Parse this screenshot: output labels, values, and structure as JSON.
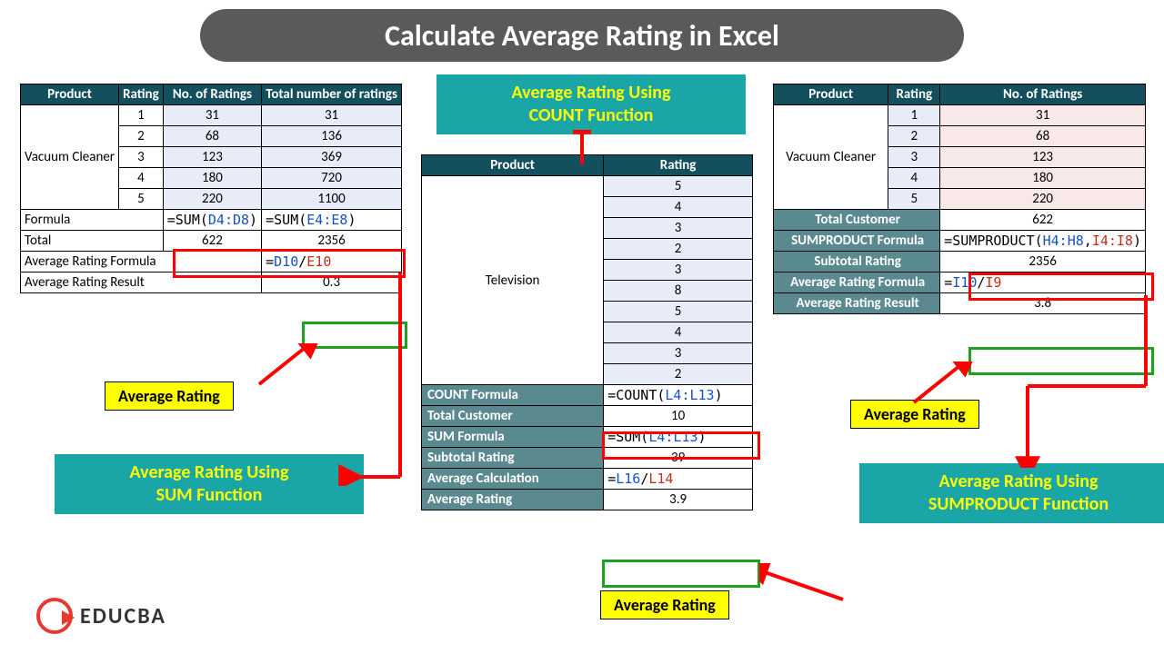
{
  "title": "Calculate Average Rating in Excel",
  "logo": "EDUCBA",
  "left_table": {
    "headers": [
      "Product",
      "Rating",
      "No. of Ratings",
      "Total number of ratings"
    ],
    "product": "Vacuum Cleaner",
    "rows": [
      {
        "rating": "1",
        "num": "31",
        "total": "31"
      },
      {
        "rating": "2",
        "num": "68",
        "total": "136"
      },
      {
        "rating": "3",
        "num": "123",
        "total": "369"
      },
      {
        "rating": "4",
        "num": "180",
        "total": "720"
      },
      {
        "rating": "5",
        "num": "220",
        "total": "1100"
      }
    ],
    "formula_label": "Formula",
    "formula_num": "=SUM(D4:D8)",
    "formula_num_range": "D4:D8",
    "formula_tot": "=SUM(E4:E8)",
    "formula_tot_range": "E4:E8",
    "total_label": "Total",
    "total_num": "622",
    "total_tot": "2356",
    "avg_formula_label": "Average Rating Formula",
    "avg_formula": "=D10/E10",
    "avg_formula_a": "D10",
    "avg_formula_b": "E10",
    "avg_result_label": "Average Rating Result",
    "avg_result": "0.3"
  },
  "center_table": {
    "headers": [
      "Product",
      "Rating"
    ],
    "product": "Television",
    "ratings": [
      "5",
      "4",
      "3",
      "2",
      "3",
      "8",
      "5",
      "4",
      "3",
      "2"
    ],
    "count_formula_label": "COUNT Formula",
    "count_formula": "=COUNT(L4:L13)",
    "count_range": "L4:L13",
    "total_customer_label": "Total Customer",
    "total_customer": "10",
    "sum_formula_label": "SUM Formula",
    "sum_formula": "=SUM(L4:L13)",
    "sum_range": "L4:L13",
    "subtotal_label": "Subtotal Rating",
    "subtotal": "39",
    "avg_calc_label": "Average Calculation",
    "avg_calc": "=L16/L14",
    "avg_calc_a": "L16",
    "avg_calc_b": "L14",
    "avg_label": "Average Rating",
    "avg_result": "3.9"
  },
  "right_table": {
    "headers": [
      "Product",
      "Rating",
      "No. of Ratings"
    ],
    "product": "Vacuum Cleaner",
    "rows": [
      {
        "rating": "1",
        "num": "31"
      },
      {
        "rating": "2",
        "num": "68"
      },
      {
        "rating": "3",
        "num": "123"
      },
      {
        "rating": "4",
        "num": "180"
      },
      {
        "rating": "5",
        "num": "220"
      }
    ],
    "total_customer_label": "Total Customer",
    "total_customer": "622",
    "sumproduct_label": "SUMPRODUCT Formula",
    "sumproduct_formula": "=SUMPRODUCT(H4:H8,I4:I8)",
    "sp_range_a": "H4:H8",
    "sp_range_b": "I4:I8",
    "subtotal_label": "Subtotal Rating",
    "subtotal": "2356",
    "avg_formula_label": "Average Rating Formula",
    "avg_formula": "=I10/I9",
    "avg_formula_a": "I10",
    "avg_formula_b": "I9",
    "avg_result_label": "Average Rating Result",
    "avg_result": "3.8"
  },
  "callouts": {
    "avg_rating": "Average Rating",
    "sum_fn": "Average Rating Using SUM Function",
    "count_fn": "Average Rating Using COUNT Function",
    "sumproduct_fn": "Average Rating Using SUMPRODUCT Function"
  },
  "colors": {
    "teal": "#1aa6a6",
    "header": "#134f5c",
    "label_bg": "#5a8a8f",
    "yellow": "#ffff00"
  }
}
